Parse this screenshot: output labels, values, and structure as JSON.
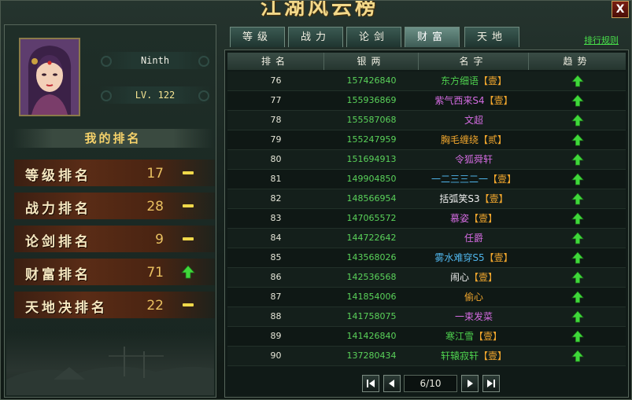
{
  "title": "江湖风云榜",
  "close_label": "X",
  "player": {
    "name": "Ninth",
    "level": "LV. 122"
  },
  "my_rank": {
    "header": "我的排名",
    "items": [
      {
        "label": "等级排名",
        "value": "17",
        "trend": "same"
      },
      {
        "label": "战力排名",
        "value": "28",
        "trend": "same"
      },
      {
        "label": "论剑排名",
        "value": "9",
        "trend": "same"
      },
      {
        "label": "财富排名",
        "value": "71",
        "trend": "up"
      },
      {
        "label": "天地决排名",
        "value": "22",
        "trend": "same"
      }
    ]
  },
  "tabs": [
    {
      "label": "等级",
      "active": false
    },
    {
      "label": "战力",
      "active": false
    },
    {
      "label": "论剑",
      "active": false
    },
    {
      "label": "财富",
      "active": true
    },
    {
      "label": "天地",
      "active": false
    }
  ],
  "rules_link": "排行规则",
  "table": {
    "headers": [
      "排名",
      "银两",
      "名字",
      "趋势"
    ],
    "rows": [
      {
        "rank": "76",
        "money": "157426840",
        "name": "东方细语",
        "guild": "【壹】",
        "name_color": "#4ed14e",
        "trend": "up"
      },
      {
        "rank": "77",
        "money": "155936869",
        "name": "紫气西来S4",
        "guild": "【壹】",
        "name_color": "#d36be0",
        "trend": "up"
      },
      {
        "rank": "78",
        "money": "155587068",
        "name": "文超",
        "guild": "",
        "name_color": "#d36be0",
        "trend": "up"
      },
      {
        "rank": "79",
        "money": "155247959",
        "name": "胸毛缠绕",
        "guild": "【贰】",
        "name_color": "#f1a62d",
        "trend": "up"
      },
      {
        "rank": "80",
        "money": "151694913",
        "name": "令狐舜轩",
        "guild": "",
        "name_color": "#d36be0",
        "trend": "up"
      },
      {
        "rank": "81",
        "money": "149904850",
        "name": "一二三三二一",
        "guild": "【壹】",
        "name_color": "#4fb4ea",
        "trend": "up"
      },
      {
        "rank": "82",
        "money": "148566954",
        "name": "括弧笑S3",
        "guild": "【壹】",
        "name_color": "#f0f0f0",
        "trend": "up"
      },
      {
        "rank": "83",
        "money": "147065572",
        "name": "慕姿",
        "guild": "【壹】",
        "name_color": "#d36be0",
        "trend": "up"
      },
      {
        "rank": "84",
        "money": "144722642",
        "name": "任爵",
        "guild": "",
        "name_color": "#d36be0",
        "trend": "up"
      },
      {
        "rank": "85",
        "money": "143568026",
        "name": "雾水难穿S5",
        "guild": "【壹】",
        "name_color": "#4fb4ea",
        "trend": "up"
      },
      {
        "rank": "86",
        "money": "142536568",
        "name": "闹心",
        "guild": "【壹】",
        "name_color": "#f0f0f0",
        "trend": "up"
      },
      {
        "rank": "87",
        "money": "141854006",
        "name": "偷心",
        "guild": "",
        "name_color": "#f1a62d",
        "trend": "up"
      },
      {
        "rank": "88",
        "money": "141758075",
        "name": "一束发菜",
        "guild": "",
        "name_color": "#d36be0",
        "trend": "up"
      },
      {
        "rank": "89",
        "money": "141426840",
        "name": "寒江雪",
        "guild": "【壹】",
        "name_color": "#4ed14e",
        "trend": "up"
      },
      {
        "rank": "90",
        "money": "137280434",
        "name": "轩辕寂轩",
        "guild": "【壹】",
        "name_color": "#4ed14e",
        "trend": "up"
      }
    ]
  },
  "pager": {
    "page": "6/10",
    "first": "first-page-icon",
    "prev": "prev-page-icon",
    "next": "next-page-icon",
    "last": "last-page-icon"
  },
  "colors": {
    "up_arrow": "#3fd83a",
    "dash": "#f0d84a",
    "money": "#5ad25a",
    "guild": "#f1a62d"
  }
}
